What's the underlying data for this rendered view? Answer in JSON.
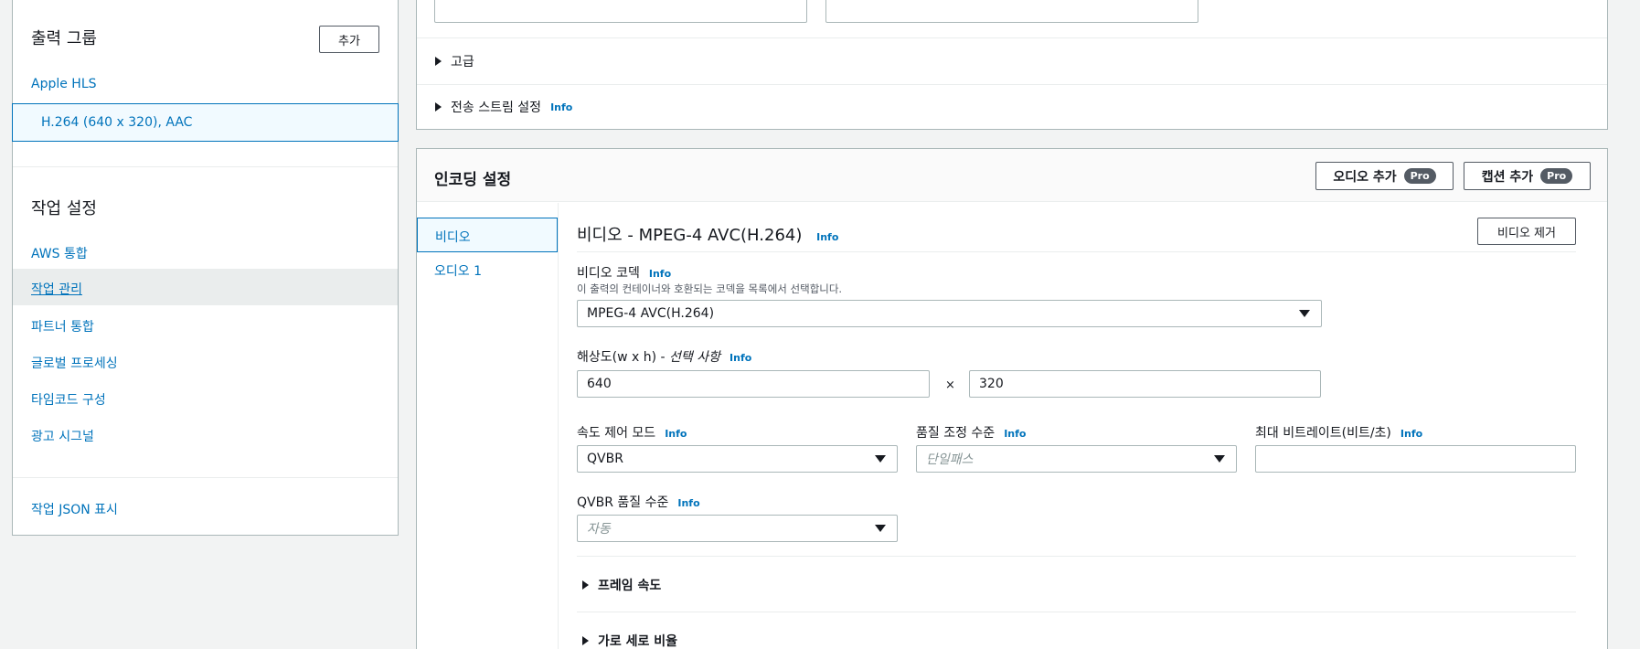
{
  "sidebar": {
    "output_group_title": "출력 그룹",
    "add_button": "추가",
    "group_name": "Apple HLS",
    "selected_output": "H.264 (640 x 320), AAC",
    "job_settings_title": "작업 설정",
    "items": [
      {
        "label": "AWS 통합"
      },
      {
        "label": "작업 관리"
      },
      {
        "label": "파트너 통합"
      },
      {
        "label": "글로벌 프로세싱"
      },
      {
        "label": "타임코드 구성"
      },
      {
        "label": "광고 시그널"
      }
    ],
    "show_json": "작업 JSON 표시"
  },
  "top_panel": {
    "advanced": "고급",
    "transport_stream": "전송 스트림 설정",
    "info": "Info"
  },
  "encoding": {
    "title": "인코딩 설정",
    "add_audio": "오디오 추가",
    "add_caption": "캡션 추가",
    "pro_badge": "Pro",
    "tabs": [
      {
        "label": "비디오"
      },
      {
        "label": "오디오 1"
      }
    ],
    "video": {
      "heading": "비디오 - MPEG-4 AVC(H.264)",
      "remove_button": "비디오 제거",
      "codec_label": "비디오 코덱",
      "codec_desc": "이 출력의 컨테이너와 호환되는 코덱을 목록에서 선택합니다.",
      "codec_value": "MPEG-4 AVC(H.264)",
      "resolution_label": "해상도(w x h) - ",
      "resolution_optional": "선택 사항",
      "width": "640",
      "times": "×",
      "height": "320",
      "rate_control_label": "속도 제어 모드",
      "rate_control_value": "QVBR",
      "quality_tuning_label": "품질 조정 수준",
      "quality_tuning_placeholder": "단일패스",
      "max_bitrate_label": "최대 비트레이트(비트/초)",
      "max_bitrate_value": "",
      "qvbr_label": "QVBR 품질 수준",
      "qvbr_placeholder": "자동",
      "frame_rate": "프레임 속도",
      "aspect_ratio": "가로 세로 비율"
    }
  }
}
